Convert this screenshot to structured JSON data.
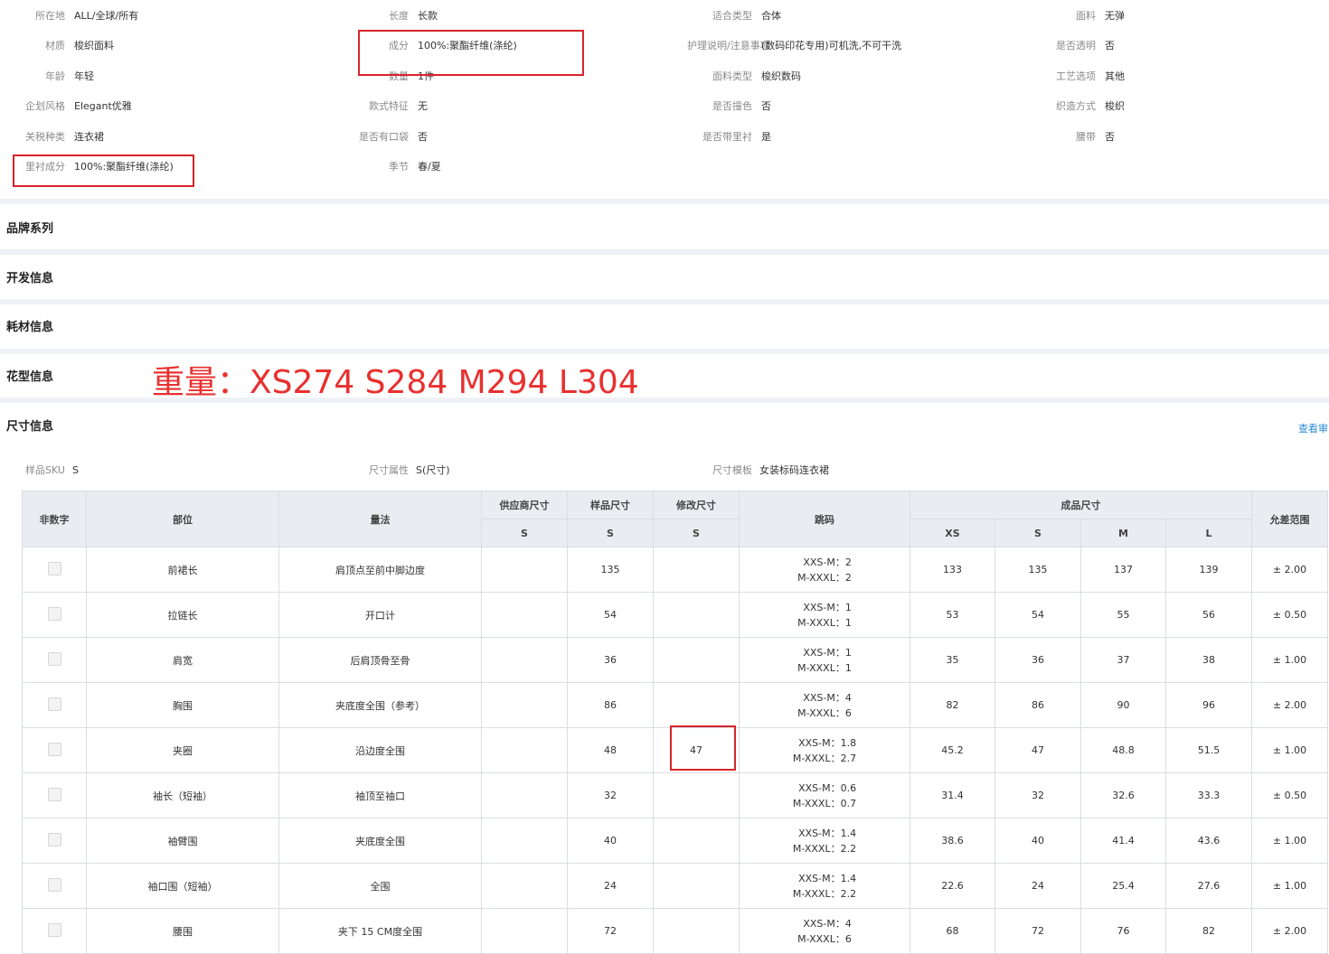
{
  "attributes": [
    {
      "label": "所在地",
      "value": "ALL/全球/所有"
    },
    {
      "label": "长度",
      "value": "长款"
    },
    {
      "label": "适合类型",
      "value": "合体"
    },
    {
      "label": "面料",
      "value": "无弹"
    },
    {
      "label": "材质",
      "value": "梭织面料"
    },
    {
      "label": "成分",
      "value": "100%:聚酯纤维(涤纶)"
    },
    {
      "label": "护理说明/注意事项",
      "value": "(数码印花专用)可机洗,不可干洗"
    },
    {
      "label": "是否透明",
      "value": "否"
    },
    {
      "label": "年龄",
      "value": "年轻"
    },
    {
      "label": "数量",
      "value": "1件"
    },
    {
      "label": "面料类型",
      "value": "梭织数码"
    },
    {
      "label": "工艺选项",
      "value": "其他"
    },
    {
      "label": "企划风格",
      "value": "Elegant优雅"
    },
    {
      "label": "款式特征",
      "value": "无"
    },
    {
      "label": "是否撞色",
      "value": "否"
    },
    {
      "label": "织造方式",
      "value": "梭织"
    },
    {
      "label": "关税种类",
      "value": "连衣裙"
    },
    {
      "label": "是否有口袋",
      "value": "否"
    },
    {
      "label": "是否带里衬",
      "value": "是"
    },
    {
      "label": "腰带",
      "value": "否"
    },
    {
      "label": "里衬成分",
      "value": "100%:聚酯纤维(涤纶)"
    },
    {
      "label": "季节",
      "value": "春/夏"
    }
  ],
  "sections": [
    "品牌系列",
    "开发信息",
    "耗材信息",
    "花型信息",
    "尺寸信息"
  ],
  "weight_note": "重量：XS274   S284  M294  L304",
  "view_link": "查看审",
  "size_meta": [
    {
      "label": "样品SKU",
      "value": "S"
    },
    {
      "label": "尺寸属性",
      "value": "S(尺寸)"
    },
    {
      "label": "尺寸模板",
      "value": "女装标码连衣裙"
    }
  ],
  "table": {
    "headers": {
      "non_numeric": "非数字",
      "part": "部位",
      "method": "量法",
      "supplier_size": "供应商尺寸",
      "sample_size": "样品尺寸",
      "modified_size": "修改尺寸",
      "jump": "跳码",
      "finished_size": "成品尺寸",
      "tolerance": "允差范围",
      "sub_s1": "S",
      "sub_s2": "S",
      "sub_s3": "S",
      "sizes": [
        "XS",
        "S",
        "M",
        "L"
      ]
    },
    "rows": [
      {
        "part": "前裙长",
        "method": "肩顶点至前中脚边度",
        "supplier": "",
        "sample": "135",
        "modified": "",
        "jump1": "XXS-M：2",
        "jump2": "M-XXXL：2",
        "xs": "133",
        "s": "135",
        "m": "137",
        "l": "139",
        "tol": "± 2.00"
      },
      {
        "part": "拉链长",
        "method": "开口计",
        "supplier": "",
        "sample": "54",
        "modified": "",
        "jump1": "XXS-M：1",
        "jump2": "M-XXXL：1",
        "xs": "53",
        "s": "54",
        "m": "55",
        "l": "56",
        "tol": "± 0.50"
      },
      {
        "part": "肩宽",
        "method": "后肩顶骨至骨",
        "supplier": "",
        "sample": "36",
        "modified": "",
        "jump1": "XXS-M：1",
        "jump2": "M-XXXL：1",
        "xs": "35",
        "s": "36",
        "m": "37",
        "l": "38",
        "tol": "± 1.00"
      },
      {
        "part": "胸围",
        "method": "夹底度全围（参考）",
        "supplier": "",
        "sample": "86",
        "modified": "",
        "jump1": "XXS-M：4",
        "jump2": "M-XXXL：6",
        "xs": "82",
        "s": "86",
        "m": "90",
        "l": "96",
        "tol": "± 2.00"
      },
      {
        "part": "夹圈",
        "method": "沿边度全围",
        "supplier": "",
        "sample": "48",
        "modified": "47",
        "jump1": "XXS-M：1.8",
        "jump2": "M-XXXL：2.7",
        "xs": "45.2",
        "s": "47",
        "m": "48.8",
        "l": "51.5",
        "tol": "± 1.00"
      },
      {
        "part": "袖长（短袖）",
        "method": "袖顶至袖口",
        "supplier": "",
        "sample": "32",
        "modified": "",
        "jump1": "XXS-M：0.6",
        "jump2": "M-XXXL：0.7",
        "xs": "31.4",
        "s": "32",
        "m": "32.6",
        "l": "33.3",
        "tol": "± 0.50"
      },
      {
        "part": "袖臂围",
        "method": "夹底度全围",
        "supplier": "",
        "sample": "40",
        "modified": "",
        "jump1": "XXS-M：1.4",
        "jump2": "M-XXXL：2.2",
        "xs": "38.6",
        "s": "40",
        "m": "41.4",
        "l": "43.6",
        "tol": "± 1.00"
      },
      {
        "part": "袖口围（短袖）",
        "method": "全围",
        "supplier": "",
        "sample": "24",
        "modified": "",
        "jump1": "XXS-M：1.4",
        "jump2": "M-XXXL：2.2",
        "xs": "22.6",
        "s": "24",
        "m": "25.4",
        "l": "27.6",
        "tol": "± 1.00"
      },
      {
        "part": "腰围",
        "method": "夹下 15 CM度全围",
        "supplier": "",
        "sample": "72",
        "modified": "",
        "jump1": "XXS-M：4",
        "jump2": "M-XXXL：6",
        "xs": "68",
        "s": "72",
        "m": "76",
        "l": "82",
        "tol": "± 2.00"
      }
    ]
  },
  "colors": {
    "highlight": "#d9242a",
    "note_text": "#e8302f",
    "link": "#2a8bd8",
    "header_bg": "#e9edf2"
  }
}
